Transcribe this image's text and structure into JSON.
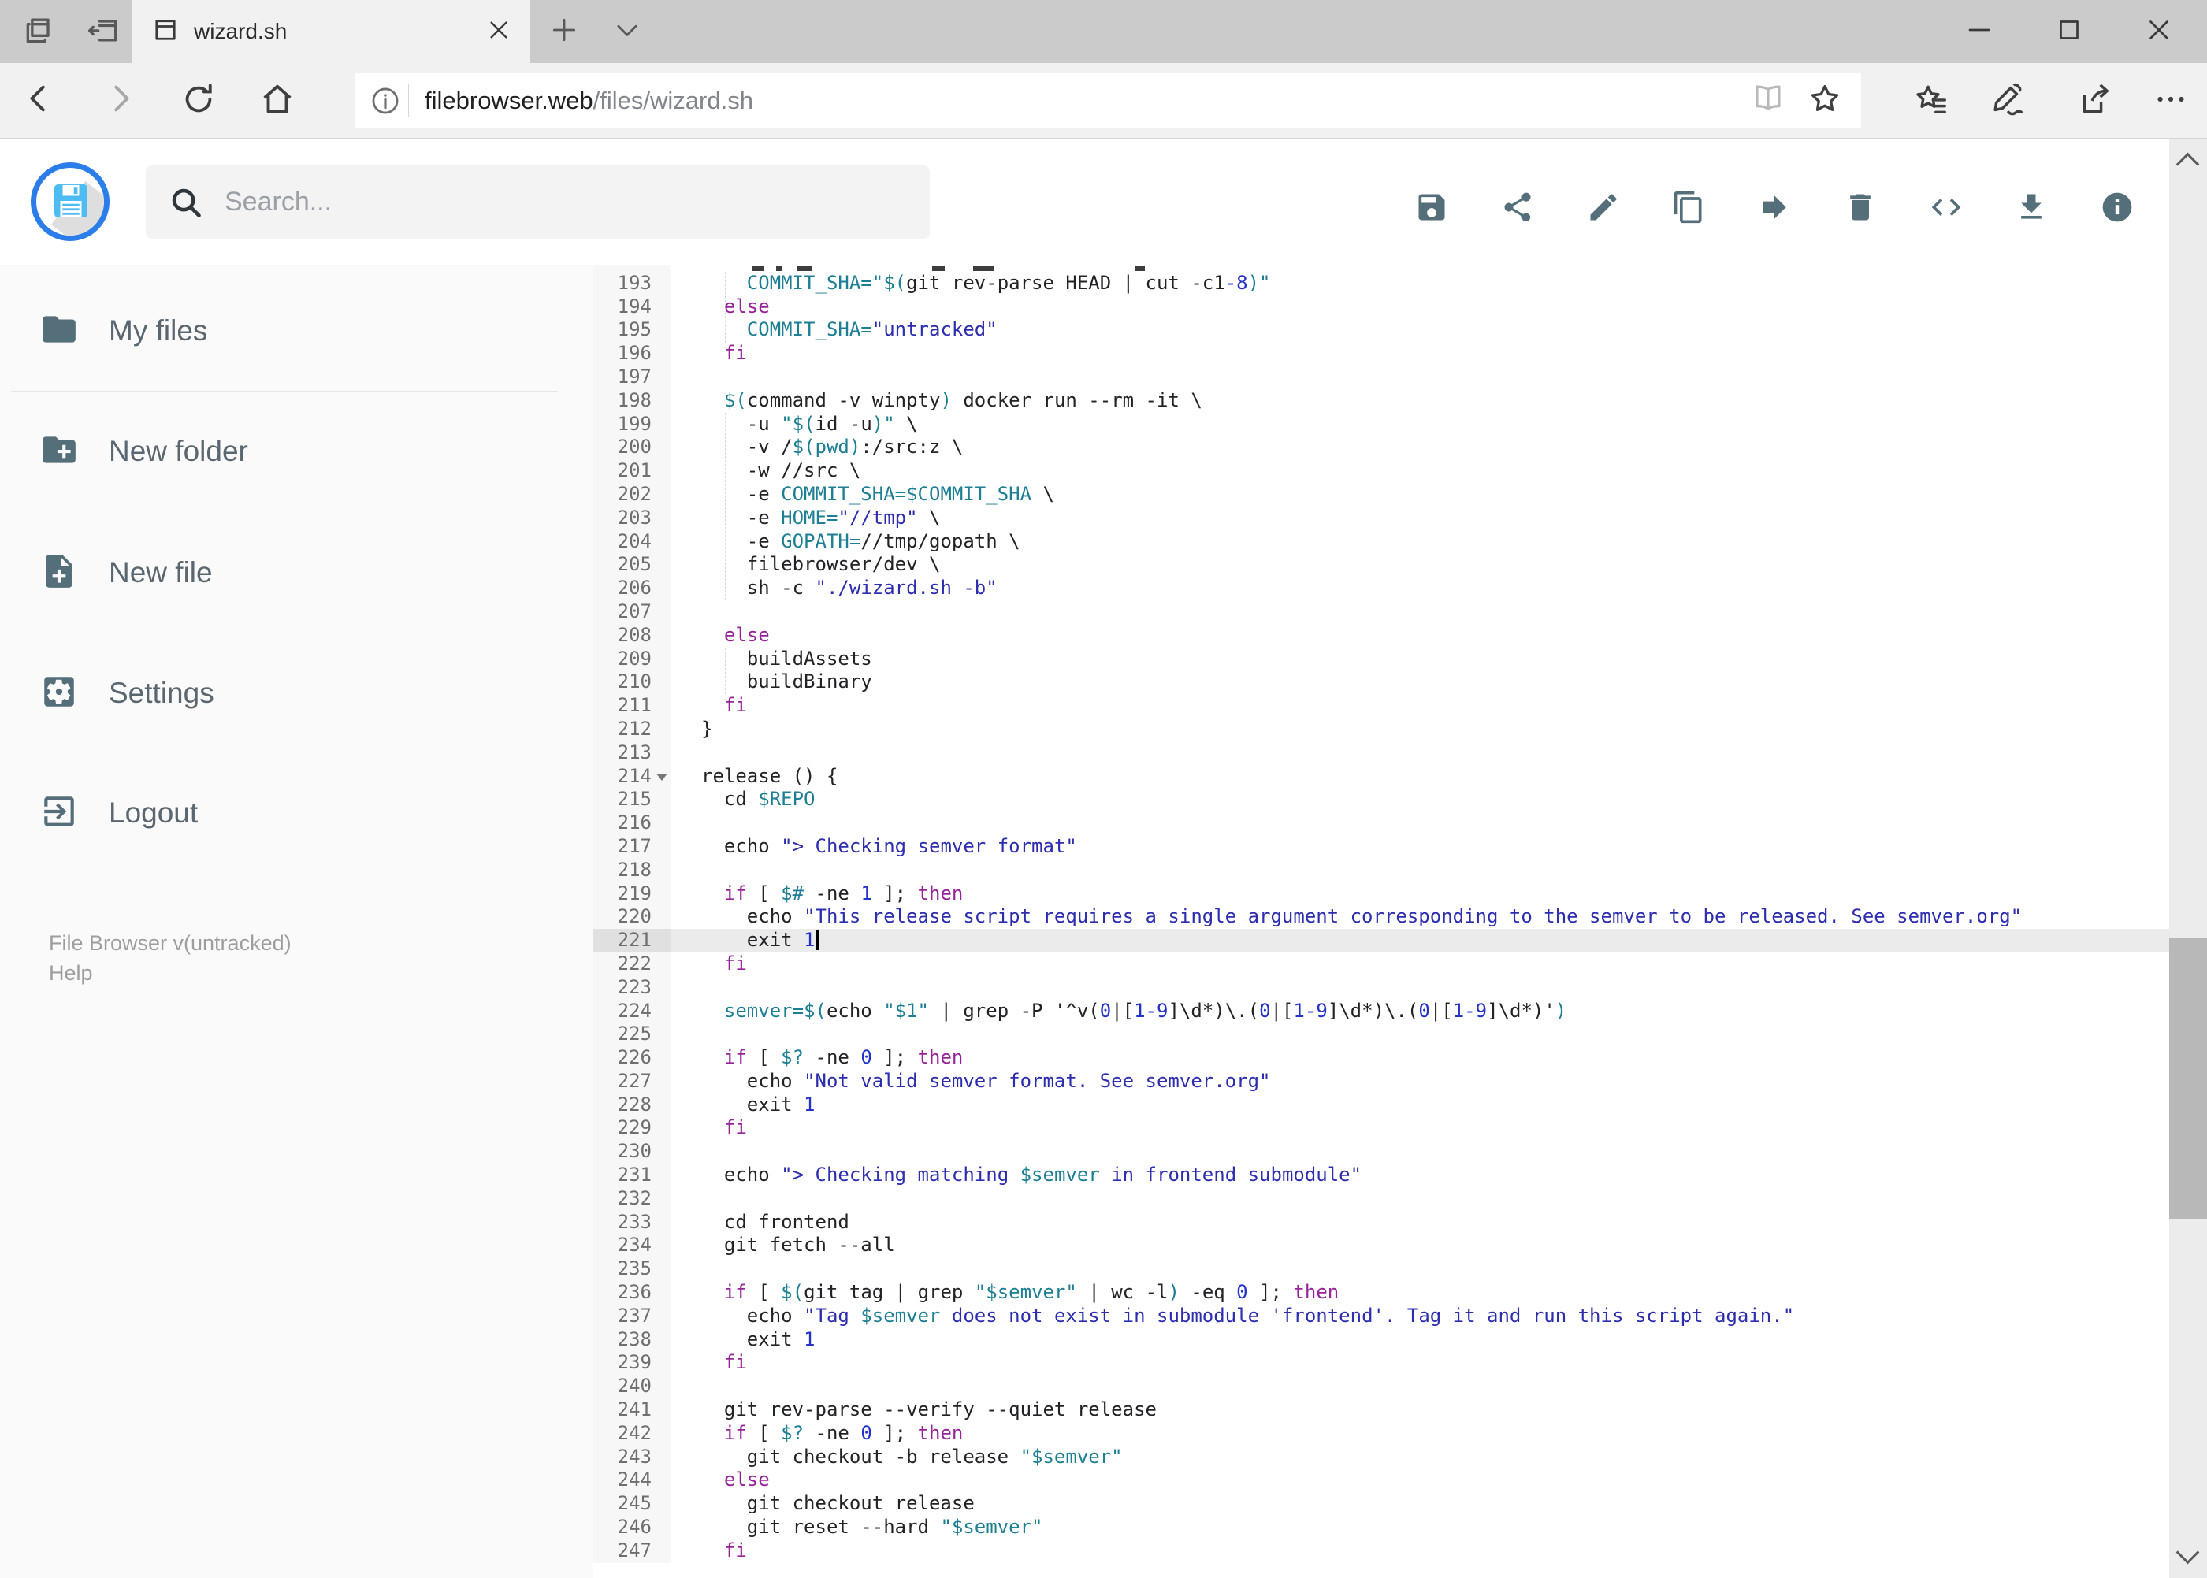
{
  "browser": {
    "tab": {
      "title": "wizard.sh"
    },
    "url": {
      "host": "filebrowser.web",
      "path": "/files/wizard.sh"
    },
    "icons": [
      "tab-preview-icon",
      "set-tabs-aside-icon",
      "page-favicon-icon",
      "close-tab-icon",
      "new-tab-icon",
      "tabs-chevron-icon",
      "minimize-icon",
      "maximize-icon",
      "close-window-icon",
      "back-icon",
      "forward-icon",
      "refresh-icon",
      "home-icon",
      "site-info-icon",
      "reading-view-icon",
      "favorite-star-icon",
      "hub-icon",
      "annotate-pen-icon",
      "share-icon",
      "more-icon"
    ]
  },
  "header": {
    "search": {
      "placeholder": "Search...",
      "value": ""
    },
    "toolbar": [
      {
        "name": "save"
      },
      {
        "name": "share"
      },
      {
        "name": "edit"
      },
      {
        "name": "copy"
      },
      {
        "name": "move"
      },
      {
        "name": "delete"
      },
      {
        "name": "code"
      },
      {
        "name": "download"
      },
      {
        "name": "info"
      }
    ]
  },
  "sidebar": {
    "items": [
      {
        "label": "My files",
        "icon": "folder-icon"
      },
      {
        "label": "New folder",
        "icon": "new-folder-icon"
      },
      {
        "label": "New file",
        "icon": "new-file-icon"
      },
      {
        "label": "Settings",
        "icon": "settings-icon"
      },
      {
        "label": "Logout",
        "icon": "logout-icon"
      }
    ],
    "footer": {
      "version": "File Browser v(untracked)",
      "help": "Help"
    }
  },
  "colors": {
    "accent_blue": "#2b7de9",
    "slate_icon": "#546e7a",
    "keyword": "#962399",
    "variable": "#1d7f93",
    "string": "#2d2daf",
    "number": "#2332c8",
    "active_line_bg": "#ebebeb"
  },
  "editor": {
    "active_line": 221,
    "lines": [
      {
        "n": "",
        "seg": []
      },
      {
        "n": "193",
        "seg": [
          [
            "p",
            "    "
          ],
          [
            "d",
            "COMMIT_SHA=\"$("
          ],
          [
            "p",
            "git rev-parse HEAD | cut -c1"
          ],
          [
            "n",
            "-8"
          ],
          [
            "d",
            ")\""
          ]
        ]
      },
      {
        "n": "194",
        "seg": [
          [
            "p",
            "  "
          ],
          [
            "k",
            "else"
          ]
        ]
      },
      {
        "n": "195",
        "seg": [
          [
            "p",
            "    "
          ],
          [
            "d",
            "COMMIT_SHA="
          ],
          [
            "s",
            "\"untracked\""
          ]
        ]
      },
      {
        "n": "196",
        "seg": [
          [
            "p",
            "  "
          ],
          [
            "k",
            "fi"
          ]
        ]
      },
      {
        "n": "197",
        "seg": []
      },
      {
        "n": "198",
        "seg": [
          [
            "p",
            "  "
          ],
          [
            "d",
            "$("
          ],
          [
            "p",
            "command -v winpty"
          ],
          [
            "d",
            ")"
          ],
          [
            "p",
            " docker run --rm -it \\"
          ]
        ]
      },
      {
        "n": "199",
        "seg": [
          [
            "p",
            "    -u "
          ],
          [
            "d",
            "\"$("
          ],
          [
            "p",
            "id -u"
          ],
          [
            "d",
            ")\""
          ],
          [
            "p",
            " \\"
          ]
        ]
      },
      {
        "n": "200",
        "seg": [
          [
            "p",
            "    -v /"
          ],
          [
            "d",
            "$(pwd)"
          ],
          [
            "p",
            ":/src:z \\"
          ]
        ]
      },
      {
        "n": "201",
        "seg": [
          [
            "p",
            "    -w //src \\"
          ]
        ]
      },
      {
        "n": "202",
        "seg": [
          [
            "p",
            "    -e "
          ],
          [
            "d",
            "COMMIT_SHA=$COMMIT_SHA"
          ],
          [
            "p",
            " \\"
          ]
        ]
      },
      {
        "n": "203",
        "seg": [
          [
            "p",
            "    -e "
          ],
          [
            "d",
            "HOME="
          ],
          [
            "s",
            "\"//tmp\""
          ],
          [
            "p",
            " \\"
          ]
        ]
      },
      {
        "n": "204",
        "seg": [
          [
            "p",
            "    -e "
          ],
          [
            "d",
            "GOPATH="
          ],
          [
            "p",
            "//tmp/gopath \\"
          ]
        ]
      },
      {
        "n": "205",
        "seg": [
          [
            "p",
            "    filebrowser/dev \\"
          ]
        ]
      },
      {
        "n": "206",
        "seg": [
          [
            "p",
            "    sh -c "
          ],
          [
            "s",
            "\"./wizard.sh -b\""
          ]
        ]
      },
      {
        "n": "207",
        "seg": []
      },
      {
        "n": "208",
        "seg": [
          [
            "p",
            "  "
          ],
          [
            "k",
            "else"
          ]
        ]
      },
      {
        "n": "209",
        "seg": [
          [
            "p",
            "    buildAssets"
          ]
        ]
      },
      {
        "n": "210",
        "seg": [
          [
            "p",
            "    buildBinary"
          ]
        ]
      },
      {
        "n": "211",
        "seg": [
          [
            "p",
            "  "
          ],
          [
            "k",
            "fi"
          ]
        ]
      },
      {
        "n": "212",
        "seg": [
          [
            "p",
            "}"
          ]
        ]
      },
      {
        "n": "213",
        "seg": []
      },
      {
        "n": "214",
        "fold": true,
        "seg": [
          [
            "p",
            "release () {"
          ]
        ]
      },
      {
        "n": "215",
        "seg": [
          [
            "p",
            "  cd "
          ],
          [
            "d",
            "$REPO"
          ]
        ]
      },
      {
        "n": "216",
        "seg": []
      },
      {
        "n": "217",
        "seg": [
          [
            "p",
            "  echo "
          ],
          [
            "s",
            "\"> Checking semver format\""
          ]
        ]
      },
      {
        "n": "218",
        "seg": []
      },
      {
        "n": "219",
        "seg": [
          [
            "p",
            "  "
          ],
          [
            "k",
            "if"
          ],
          [
            "p",
            " [ "
          ],
          [
            "d",
            "$#"
          ],
          [
            "p",
            " -ne "
          ],
          [
            "n",
            "1"
          ],
          [
            "p",
            " ]; "
          ],
          [
            "k",
            "then"
          ]
        ]
      },
      {
        "n": "220",
        "seg": [
          [
            "p",
            "    echo "
          ],
          [
            "s",
            "\"This release script requires a single argument corresponding to the semver to be released. See semver.org\""
          ]
        ]
      },
      {
        "n": "221",
        "active": true,
        "caret": true,
        "seg": [
          [
            "p",
            "    exit "
          ],
          [
            "n",
            "1"
          ]
        ]
      },
      {
        "n": "222",
        "seg": [
          [
            "p",
            "  "
          ],
          [
            "k",
            "fi"
          ]
        ]
      },
      {
        "n": "223",
        "seg": []
      },
      {
        "n": "224",
        "seg": [
          [
            "p",
            "  "
          ],
          [
            "d",
            "semver=$("
          ],
          [
            "p",
            "echo "
          ],
          [
            "d",
            "\"$1\""
          ],
          [
            "p",
            " | grep -P '^v("
          ],
          [
            "n",
            "0"
          ],
          [
            "p",
            "|["
          ],
          [
            "n",
            "1-9"
          ],
          [
            "p",
            "]\\d*)\\.("
          ],
          [
            "n",
            "0"
          ],
          [
            "p",
            "|["
          ],
          [
            "n",
            "1-9"
          ],
          [
            "p",
            "]\\d*)\\.("
          ],
          [
            "n",
            "0"
          ],
          [
            "p",
            "|["
          ],
          [
            "n",
            "1-9"
          ],
          [
            "p",
            "]\\d*)'"
          ],
          [
            "d",
            ")"
          ]
        ]
      },
      {
        "n": "225",
        "seg": []
      },
      {
        "n": "226",
        "seg": [
          [
            "p",
            "  "
          ],
          [
            "k",
            "if"
          ],
          [
            "p",
            " [ "
          ],
          [
            "d",
            "$?"
          ],
          [
            "p",
            " -ne "
          ],
          [
            "n",
            "0"
          ],
          [
            "p",
            " ]; "
          ],
          [
            "k",
            "then"
          ]
        ]
      },
      {
        "n": "227",
        "seg": [
          [
            "p",
            "    echo "
          ],
          [
            "s",
            "\"Not valid semver format. See semver.org\""
          ]
        ]
      },
      {
        "n": "228",
        "seg": [
          [
            "p",
            "    exit "
          ],
          [
            "n",
            "1"
          ]
        ]
      },
      {
        "n": "229",
        "seg": [
          [
            "p",
            "  "
          ],
          [
            "k",
            "fi"
          ]
        ]
      },
      {
        "n": "230",
        "seg": []
      },
      {
        "n": "231",
        "seg": [
          [
            "p",
            "  echo "
          ],
          [
            "s",
            "\"> Checking matching "
          ],
          [
            "d",
            "$semver"
          ],
          [
            "s",
            " in frontend submodule\""
          ]
        ]
      },
      {
        "n": "232",
        "seg": []
      },
      {
        "n": "233",
        "seg": [
          [
            "p",
            "  cd frontend"
          ]
        ]
      },
      {
        "n": "234",
        "seg": [
          [
            "p",
            "  git fetch --all"
          ]
        ]
      },
      {
        "n": "235",
        "seg": []
      },
      {
        "n": "236",
        "seg": [
          [
            "p",
            "  "
          ],
          [
            "k",
            "if"
          ],
          [
            "p",
            " [ "
          ],
          [
            "d",
            "$("
          ],
          [
            "p",
            "git tag | grep "
          ],
          [
            "d",
            "\"$semver\""
          ],
          [
            "p",
            " | wc -l"
          ],
          [
            "d",
            ")"
          ],
          [
            "p",
            " -eq "
          ],
          [
            "n",
            "0"
          ],
          [
            "p",
            " ]; "
          ],
          [
            "k",
            "then"
          ]
        ]
      },
      {
        "n": "237",
        "seg": [
          [
            "p",
            "    echo "
          ],
          [
            "s",
            "\"Tag "
          ],
          [
            "d",
            "$semver"
          ],
          [
            "s",
            " does not exist in submodule 'frontend'. Tag it and run this script again.\""
          ]
        ]
      },
      {
        "n": "238",
        "seg": [
          [
            "p",
            "    exit "
          ],
          [
            "n",
            "1"
          ]
        ]
      },
      {
        "n": "239",
        "seg": [
          [
            "p",
            "  "
          ],
          [
            "k",
            "fi"
          ]
        ]
      },
      {
        "n": "240",
        "seg": []
      },
      {
        "n": "241",
        "seg": [
          [
            "p",
            "  git rev-parse --verify --quiet release"
          ]
        ]
      },
      {
        "n": "242",
        "seg": [
          [
            "p",
            "  "
          ],
          [
            "k",
            "if"
          ],
          [
            "p",
            " [ "
          ],
          [
            "d",
            "$?"
          ],
          [
            "p",
            " -ne "
          ],
          [
            "n",
            "0"
          ],
          [
            "p",
            " ]; "
          ],
          [
            "k",
            "then"
          ]
        ]
      },
      {
        "n": "243",
        "seg": [
          [
            "p",
            "    git checkout -b release "
          ],
          [
            "d",
            "\"$semver\""
          ]
        ]
      },
      {
        "n": "244",
        "seg": [
          [
            "p",
            "  "
          ],
          [
            "k",
            "else"
          ]
        ]
      },
      {
        "n": "245",
        "seg": [
          [
            "p",
            "    git checkout release"
          ]
        ]
      },
      {
        "n": "246",
        "seg": [
          [
            "p",
            "    git reset --hard "
          ],
          [
            "d",
            "\"$semver\""
          ]
        ]
      },
      {
        "n": "247",
        "seg": [
          [
            "p",
            "  "
          ],
          [
            "k",
            "fi"
          ]
        ]
      }
    ]
  }
}
